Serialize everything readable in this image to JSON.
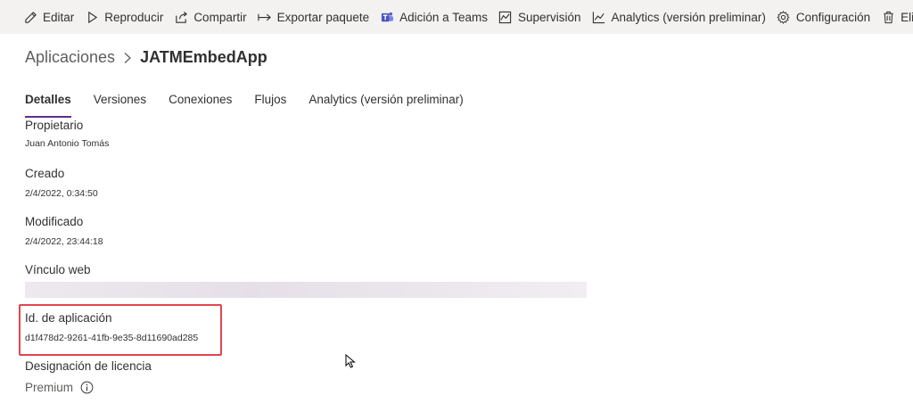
{
  "commandbar": {
    "items": [
      {
        "label": "Editar",
        "icon": "pencil-icon"
      },
      {
        "label": "Reproducir",
        "icon": "play-icon"
      },
      {
        "label": "Compartir",
        "icon": "share-icon"
      },
      {
        "label": "Exportar paquete",
        "icon": "export-arrow-icon"
      },
      {
        "label": "Adición a Teams",
        "icon": "teams-icon"
      },
      {
        "label": "Supervisión",
        "icon": "monitor-chart-icon"
      },
      {
        "label": "Analytics (versión preliminar)",
        "icon": "line-chart-icon"
      },
      {
        "label": "Configuración",
        "icon": "gear-icon"
      },
      {
        "label": "Eliminar",
        "icon": "trash-icon"
      }
    ]
  },
  "breadcrumb": {
    "parent": "Aplicaciones",
    "current": "JATMEmbedApp"
  },
  "tabs": [
    {
      "label": "Detalles",
      "active": true
    },
    {
      "label": "Versiones",
      "active": false
    },
    {
      "label": "Conexiones",
      "active": false
    },
    {
      "label": "Flujos",
      "active": false
    },
    {
      "label": "Analytics (versión preliminar)",
      "active": false
    }
  ],
  "details": {
    "owner": {
      "label": "Propietario",
      "value": "Juan Antonio Tomás"
    },
    "created": {
      "label": "Creado",
      "value": "2/4/2022, 0:34:50"
    },
    "modified": {
      "label": "Modificado",
      "value": "2/4/2022, 23:44:18"
    },
    "weblink": {
      "label": "Vínculo web"
    },
    "appid": {
      "label": "Id. de aplicación",
      "value": "d1f478d2-9261-41fb-9e35-8d11690ad285"
    },
    "license": {
      "label": "Designación de licencia",
      "value": "Premium",
      "icon": "info-icon"
    }
  },
  "colors": {
    "commandbar_bg": "#f3f2f1",
    "tab_accent": "#5c2d91",
    "highlight": "#e0464e"
  }
}
